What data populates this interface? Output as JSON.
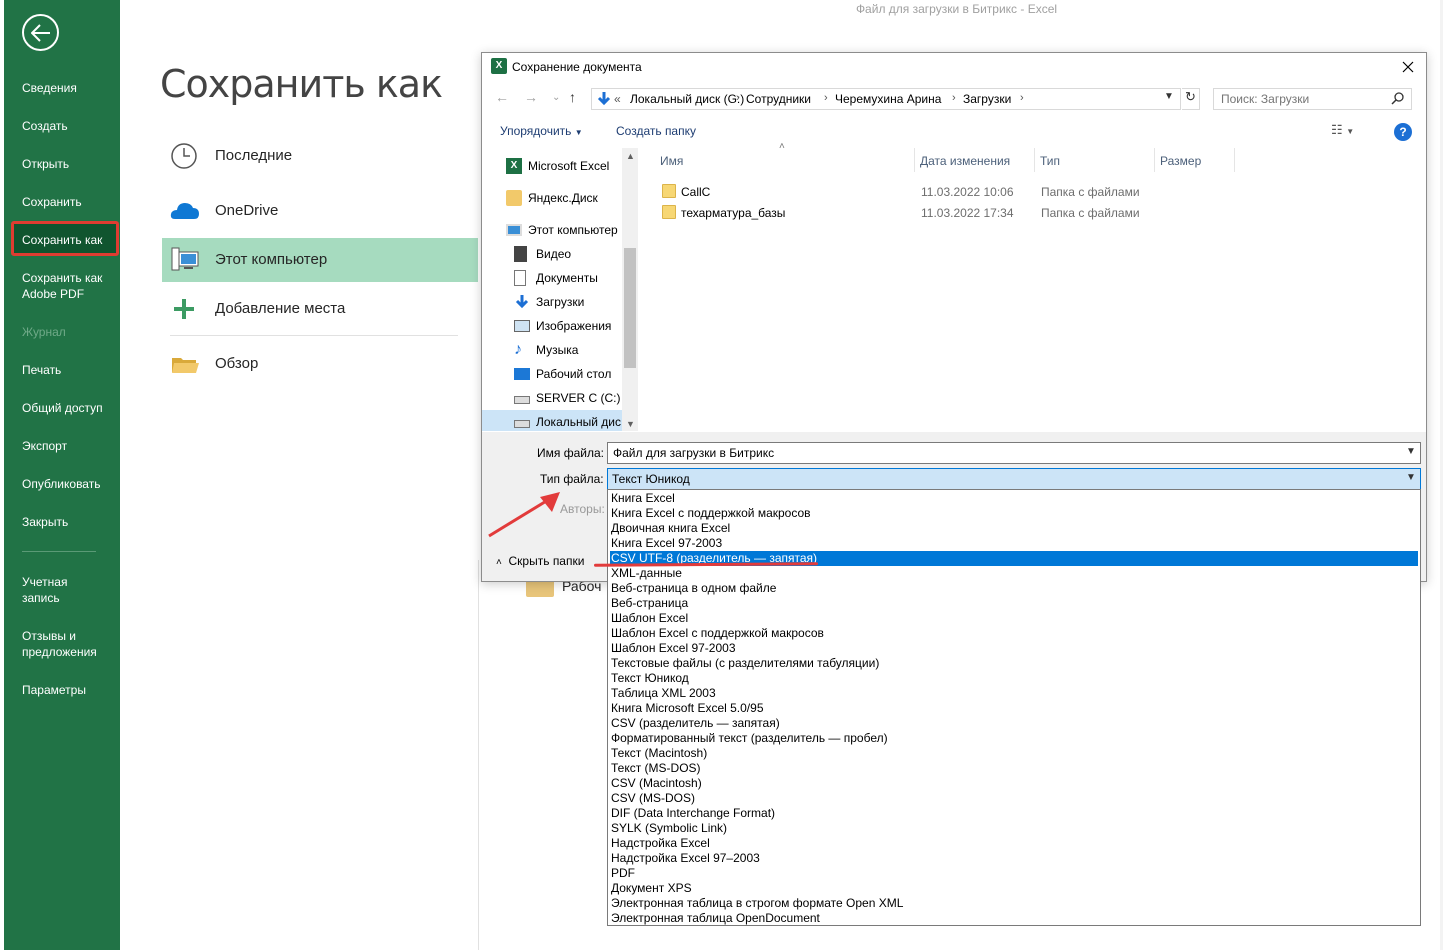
{
  "window": {
    "title": "Файл для загрузки в Битрикс  -  Excel"
  },
  "nav": {
    "items": [
      {
        "label": "Сведения",
        "enabled": true
      },
      {
        "label": "Создать",
        "enabled": true
      },
      {
        "label": "Открыть",
        "enabled": true
      },
      {
        "label": "Сохранить",
        "enabled": true
      },
      {
        "label": "Сохранить как",
        "enabled": true,
        "selected": true
      },
      {
        "label": "Сохранить как Adobe PDF",
        "enabled": true
      },
      {
        "label": "Журнал",
        "enabled": false
      },
      {
        "label": "Печать",
        "enabled": true
      },
      {
        "label": "Общий доступ",
        "enabled": true
      },
      {
        "label": "Экспорт",
        "enabled": true
      },
      {
        "label": "Опубликовать",
        "enabled": true
      },
      {
        "label": "Закрыть",
        "enabled": true
      },
      {
        "label": "Учетная запись",
        "enabled": true
      },
      {
        "label": "Отзывы и предложения",
        "enabled": true
      },
      {
        "label": "Параметры",
        "enabled": true
      }
    ]
  },
  "saveas": {
    "title": "Сохранить как",
    "locations": [
      {
        "label": "Последние",
        "icon": "clock-icon"
      },
      {
        "label": "OneDrive",
        "icon": "cloud-icon"
      },
      {
        "label": "Этот компьютер",
        "icon": "computer-icon",
        "selected": true
      },
      {
        "label": "Добавление места",
        "icon": "plus-icon"
      },
      {
        "label": "Обзор",
        "icon": "folder-open-icon"
      }
    ],
    "background_folder_label": "Рабоч"
  },
  "dialog": {
    "title": "Сохранение документа",
    "address": {
      "crumbs": [
        "«",
        "Локальный диск (G:)",
        "Сотрудники",
        "Черемухина Арина",
        "Загрузки"
      ]
    },
    "search": {
      "placeholder": "Поиск: Загрузки"
    },
    "toolbar": {
      "organize": "Упорядочить",
      "new_folder": "Создать папку"
    },
    "tree": [
      {
        "label": "Microsoft Excel",
        "icon": "excel-icon"
      },
      {
        "label": "Яндекс.Диск",
        "icon": "yandex-disk-icon"
      },
      {
        "label": "Этот компьютер",
        "icon": "computer-icon"
      },
      {
        "label": "Видео",
        "icon": "video-icon"
      },
      {
        "label": "Документы",
        "icon": "documents-icon"
      },
      {
        "label": "Загрузки",
        "icon": "downloads-icon"
      },
      {
        "label": "Изображения",
        "icon": "pictures-icon"
      },
      {
        "label": "Музыка",
        "icon": "music-icon"
      },
      {
        "label": "Рабочий стол",
        "icon": "desktop-icon"
      },
      {
        "label": "SERVER C (C:)",
        "icon": "drive-icon"
      },
      {
        "label": "Локальный дис",
        "icon": "drive-icon",
        "selected": true
      }
    ],
    "columns": [
      "Имя",
      "Дата изменения",
      "Тип",
      "Размер"
    ],
    "files": [
      {
        "name": "CallC",
        "date": "11.03.2022 10:06",
        "type": "Папка с файлами"
      },
      {
        "name": "техарматура_базы",
        "date": "11.03.2022 17:34",
        "type": "Папка с файлами"
      }
    ],
    "filename_label": "Имя файла:",
    "filename_value": "Файл для загрузки в Битрикс",
    "filetype_label": "Тип файла:",
    "filetype_value": "Текст Юникод",
    "authors_label": "Авторы:",
    "hide_folders": "Скрыть папки"
  },
  "type_options": [
    "Книга Excel",
    "Книга Excel с поддержкой макросов",
    "Двоичная книга Excel",
    "Книга Excel 97-2003",
    "CSV UTF-8 (разделитель — запятая)",
    "XML-данные",
    "Веб-страница в одном файле",
    "Веб-страница",
    "Шаблон Excel",
    "Шаблон Excel с поддержкой макросов",
    "Шаблон Excel 97-2003",
    "Текстовые файлы (с разделителями табуляции)",
    "Текст Юникод",
    "Таблица XML 2003",
    "Книга Microsoft Excel 5.0/95",
    "CSV (разделитель — запятая)",
    "Форматированный текст (разделитель — пробел)",
    "Текст (Macintosh)",
    "Текст (MS-DOS)",
    "CSV (Macintosh)",
    "CSV (MS-DOS)",
    "DIF (Data Interchange Format)",
    "SYLK (Symbolic Link)",
    "Надстройка Excel",
    "Надстройка Excel 97–2003",
    "PDF",
    "Документ XPS",
    "Электронная таблица в строгом формате Open XML",
    "Электронная таблица OpenDocument"
  ],
  "type_selected_index": 4,
  "colors": {
    "nav_bg": "#217346",
    "nav_selected": "#10552f",
    "location_selected": "#a6dbbf",
    "list_selection": "#0078d7",
    "annotation": "#e23b3b"
  }
}
